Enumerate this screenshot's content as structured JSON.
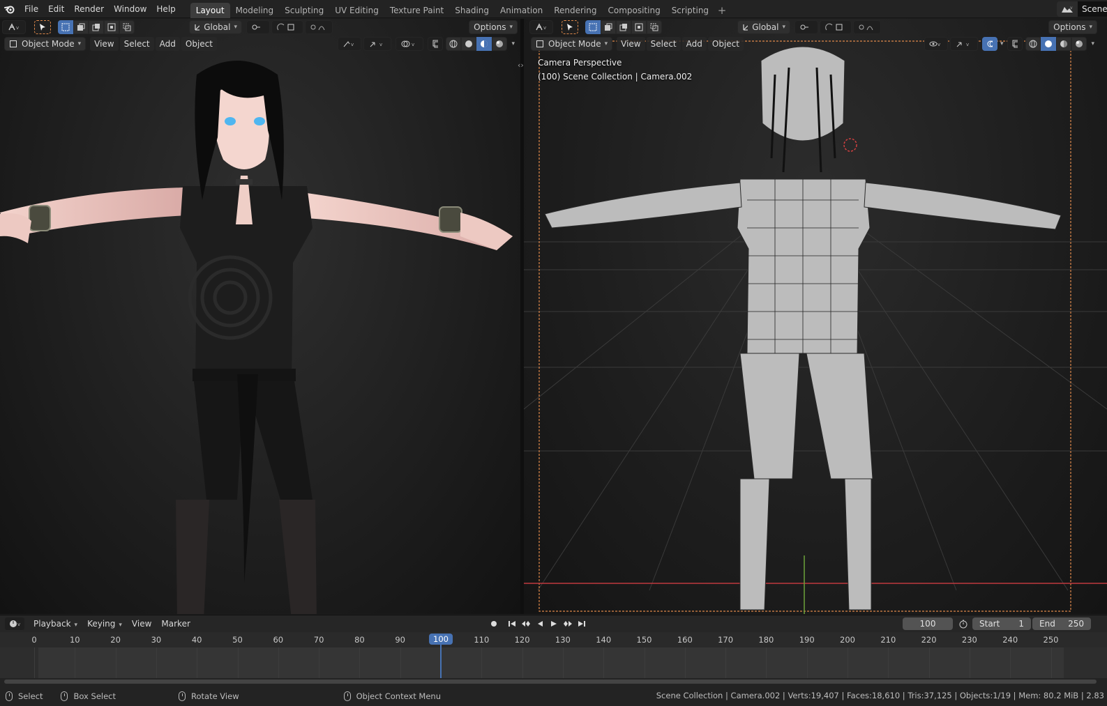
{
  "app": {
    "logo": "blender-logo-icon",
    "menus": [
      "File",
      "Edit",
      "Render",
      "Window",
      "Help"
    ],
    "workspaces": [
      "Layout",
      "Modeling",
      "Sculpting",
      "UV Editing",
      "Texture Paint",
      "Shading",
      "Animation",
      "Rendering",
      "Compositing",
      "Scripting"
    ],
    "active_workspace": "Layout",
    "scene_name": "Scene"
  },
  "left_viewport": {
    "transform_orientation": "Global",
    "options_label": "Options",
    "mode": "Object Mode",
    "menus": [
      "View",
      "Select",
      "Add",
      "Object"
    ]
  },
  "right_viewport": {
    "transform_orientation": "Global",
    "options_label": "Options",
    "mode": "Object Mode",
    "menus": [
      "View",
      "Select",
      "Add",
      "Object"
    ],
    "overlay_line1": "Camera Perspective",
    "overlay_line2": "(100) Scene Collection | Camera.002"
  },
  "timeline": {
    "menus": [
      "Playback",
      "Keying",
      "View",
      "Marker"
    ],
    "current_frame": "100",
    "start_label": "Start",
    "start": "1",
    "end_label": "End",
    "end": "250",
    "ticks": [
      "0",
      "10",
      "20",
      "30",
      "40",
      "50",
      "60",
      "70",
      "80",
      "90",
      "100",
      "110",
      "120",
      "130",
      "140",
      "150",
      "160",
      "170",
      "180",
      "190",
      "200",
      "210",
      "220",
      "230",
      "240",
      "250"
    ]
  },
  "status": {
    "select": "Select",
    "box_select": "Box Select",
    "rotate_view": "Rotate View",
    "context_menu": "Object Context Menu",
    "stats": "Scene Collection | Camera.002 | Verts:19,407 | Faces:18,610 | Tris:37,125 | Objects:1/19 | Mem: 80.2 MiB | 2.83"
  },
  "colors": {
    "accent": "#4772b3",
    "camera_frame": "#e0894a",
    "x_axis": "#c0393e",
    "y_axis": "#6ca33a"
  }
}
